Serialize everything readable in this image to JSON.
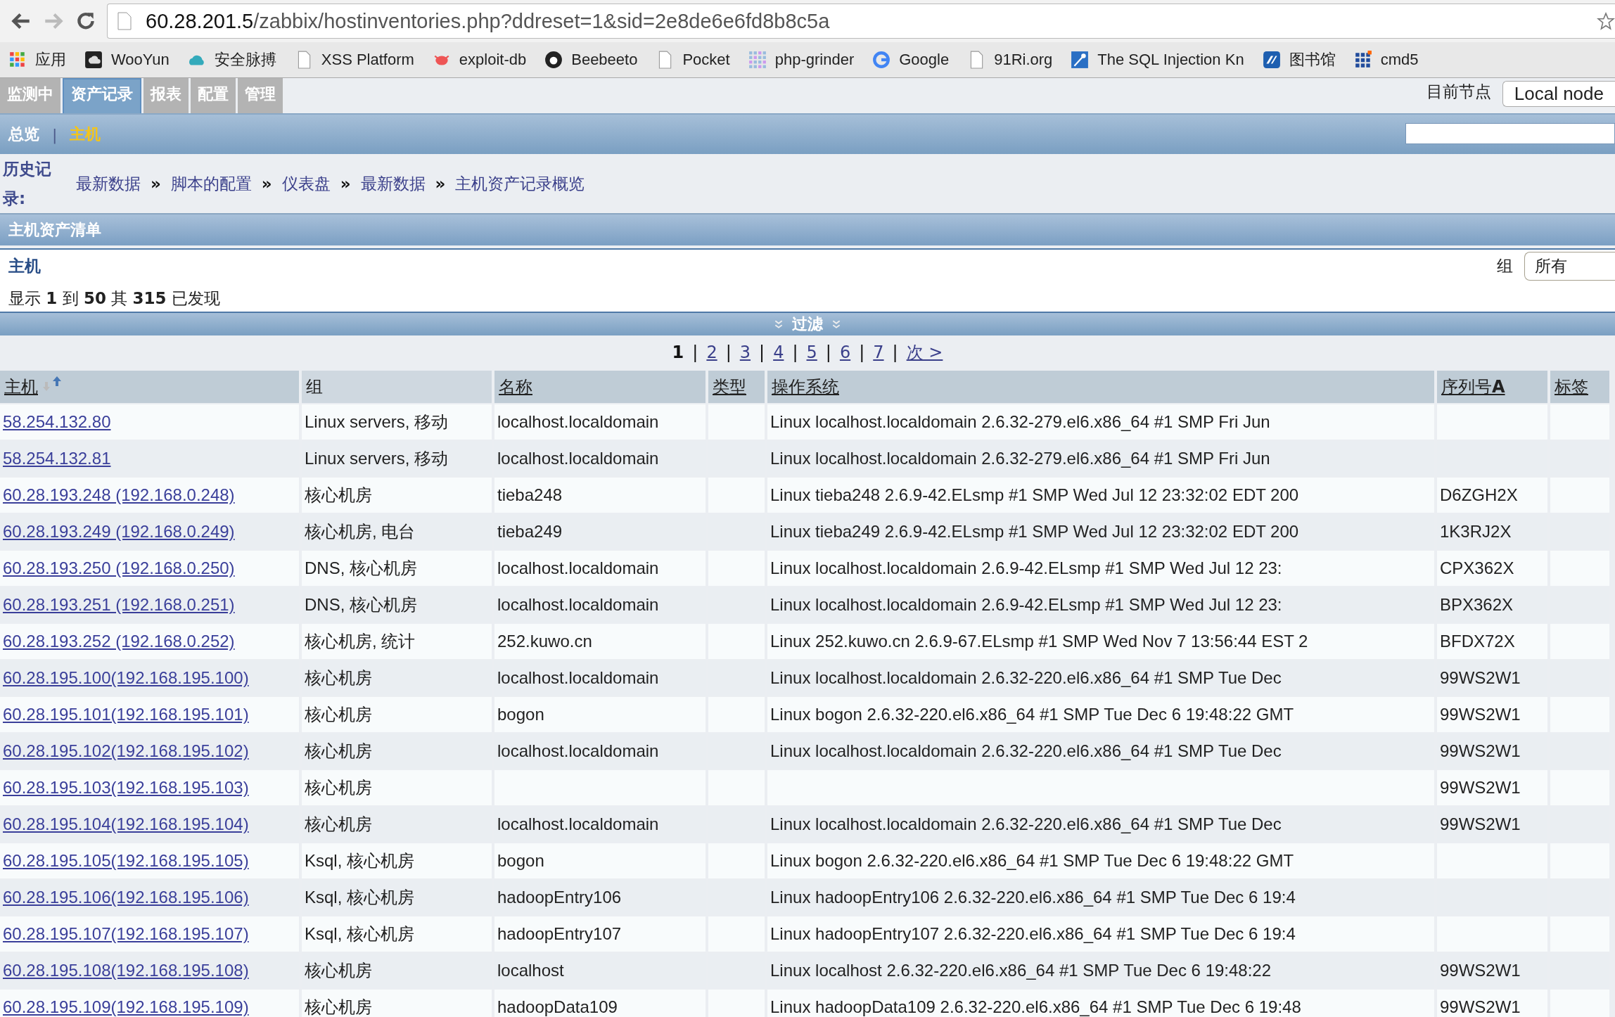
{
  "browser": {
    "url_host": "60.28.201.5",
    "url_path": "/zabbix/hostinventories.php?ddreset=1&sid=2e8de6e6fd8b8c5a",
    "bookmarks": [
      {
        "label": "应用",
        "kind": "apps"
      },
      {
        "label": "WooYun",
        "kind": "dark"
      },
      {
        "label": "安全脉搏",
        "kind": "cloud"
      },
      {
        "label": "XSS Platform",
        "kind": "page"
      },
      {
        "label": "exploit-db",
        "kind": "bug"
      },
      {
        "label": "Beebeeto",
        "kind": "bee"
      },
      {
        "label": "Pocket",
        "kind": "page"
      },
      {
        "label": "php-grinder",
        "kind": "dots"
      },
      {
        "label": "Google",
        "kind": "google"
      },
      {
        "label": "91Ri.org",
        "kind": "page"
      },
      {
        "label": "The SQL Injection Kn",
        "kind": "pin"
      },
      {
        "label": "图书馆",
        "kind": "blue"
      },
      {
        "label": "cmd5",
        "kind": "squares"
      }
    ]
  },
  "main_menu": [
    {
      "label": "监测中",
      "selected": false
    },
    {
      "label": "资产记录",
      "selected": true
    },
    {
      "label": "报表",
      "selected": false
    },
    {
      "label": "配置",
      "selected": false
    },
    {
      "label": "管理",
      "selected": false
    }
  ],
  "node": {
    "label": "目前节点",
    "value": "Local node"
  },
  "sub_menu": [
    {
      "label": "总览",
      "selected": false
    },
    {
      "label": "主机",
      "selected": true
    }
  ],
  "sub_separator": "|",
  "history": {
    "label": "历史记录:",
    "items": [
      "最新数据",
      "脚本的配置",
      "仪表盘",
      "最新数据",
      "主机资产记录概览"
    ],
    "separator": "»"
  },
  "section_title": "主机资产清单",
  "panel": {
    "title": "主机",
    "group_label": "组",
    "group_value": "所有",
    "summary": "显示 **1** 到 **50** 其 **315** 已发现"
  },
  "filter": {
    "label": "过滤"
  },
  "pagination": {
    "pages": [
      {
        "label": "1",
        "selected": true
      },
      {
        "label": "2",
        "selected": false
      },
      {
        "label": "3",
        "selected": false
      },
      {
        "label": "4",
        "selected": false
      },
      {
        "label": "5",
        "selected": false
      },
      {
        "label": "6",
        "selected": false
      },
      {
        "label": "7",
        "selected": false
      }
    ],
    "next": "次 >",
    "separator": "|"
  },
  "table": {
    "columns": [
      {
        "label": "主机",
        "link": true,
        "sorted": true
      },
      {
        "label": "组",
        "link": false,
        "sorted": false
      },
      {
        "label": "名称",
        "link": true,
        "sorted": false
      },
      {
        "label": "类型",
        "link": true,
        "sorted": false
      },
      {
        "label": "操作系统",
        "link": true,
        "sorted": false
      },
      {
        "label": "序列号**A**",
        "link": true,
        "sorted": false
      },
      {
        "label": "标签",
        "link": true,
        "sorted": false
      }
    ],
    "rows": [
      {
        "host": "58.254.132.80",
        "group": "Linux servers, 移动",
        "name": "localhost.localdomain",
        "os": "Linux localhost.localdomain 2.6.32-279.el6.x86_64 #1 SMP Fri Jun"
      },
      {
        "host": "58.254.132.81",
        "group": "Linux servers, 移动",
        "name": "localhost.localdomain",
        "os": "Linux localhost.localdomain 2.6.32-279.el6.x86_64 #1 SMP Fri Jun"
      },
      {
        "host": "60.28.193.248 (192.168.0.248)",
        "group": "核心机房",
        "name": "tieba248",
        "os": "Linux tieba248 2.6.9-42.ELsmp #1 SMP Wed Jul 12 23:32:02 EDT 200",
        "serial": "D6ZGH2X"
      },
      {
        "host": "60.28.193.249 (192.168.0.249)",
        "group": "核心机房, 电台",
        "name": "tieba249",
        "os": "Linux tieba249 2.6.9-42.ELsmp #1 SMP Wed Jul 12 23:32:02 EDT 200",
        "serial": "1K3RJ2X"
      },
      {
        "host": "60.28.193.250 (192.168.0.250)",
        "group": "DNS, 核心机房",
        "name": "localhost.localdomain",
        "os": "Linux localhost.localdomain 2.6.9-42.ELsmp #1 SMP Wed Jul 12 23:",
        "serial": "CPX362X"
      },
      {
        "host": "60.28.193.251 (192.168.0.251)",
        "group": "DNS, 核心机房",
        "name": "localhost.localdomain",
        "os": "Linux localhost.localdomain 2.6.9-42.ELsmp #1 SMP Wed Jul 12 23:",
        "serial": "BPX362X"
      },
      {
        "host": "60.28.193.252 (192.168.0.252)",
        "group": "核心机房, 统计",
        "name": "252.kuwo.cn",
        "os": "Linux 252.kuwo.cn 2.6.9-67.ELsmp #1 SMP Wed Nov 7 13:56:44 EST 2",
        "serial": "BFDX72X"
      },
      {
        "host": "60.28.195.100(192.168.195.100)",
        "group": "核心机房",
        "name": "localhost.localdomain",
        "os": "Linux localhost.localdomain 2.6.32-220.el6.x86_64 #1 SMP Tue Dec",
        "serial": "99WS2W1"
      },
      {
        "host": "60.28.195.101(192.168.195.101)",
        "group": "核心机房",
        "name": "bogon",
        "os": "Linux bogon 2.6.32-220.el6.x86_64 #1 SMP Tue Dec 6 19:48:22 GMT",
        "serial": "99WS2W1"
      },
      {
        "host": "60.28.195.102(192.168.195.102)",
        "group": "核心机房",
        "name": "localhost.localdomain",
        "os": "Linux localhost.localdomain 2.6.32-220.el6.x86_64 #1 SMP Tue Dec",
        "serial": "99WS2W1"
      },
      {
        "host": "60.28.195.103(192.168.195.103)",
        "group": "核心机房",
        "serial": "99WS2W1"
      },
      {
        "host": "60.28.195.104(192.168.195.104)",
        "group": "核心机房",
        "name": "localhost.localdomain",
        "os": "Linux localhost.localdomain 2.6.32-220.el6.x86_64 #1 SMP Tue Dec",
        "serial": "99WS2W1"
      },
      {
        "host": "60.28.195.105(192.168.195.105)",
        "group": "Ksql, 核心机房",
        "name": "bogon",
        "os": "Linux bogon 2.6.32-220.el6.x86_64 #1 SMP Tue Dec 6 19:48:22 GMT"
      },
      {
        "host": "60.28.195.106(192.168.195.106)",
        "group": "Ksql, 核心机房",
        "name": "hadoopEntry106",
        "os": "Linux hadoopEntry106 2.6.32-220.el6.x86_64 #1 SMP Tue Dec 6 19:4"
      },
      {
        "host": "60.28.195.107(192.168.195.107)",
        "group": "Ksql, 核心机房",
        "name": "hadoopEntry107",
        "os": "Linux hadoopEntry107 2.6.32-220.el6.x86_64 #1 SMP Tue Dec 6 19:4"
      },
      {
        "host": "60.28.195.108(192.168.195.108)",
        "group": "核心机房",
        "name": "localhost",
        "os": "Linux localhost 2.6.32-220.el6.x86_64 #1 SMP Tue Dec 6 19:48:22",
        "serial": "99WS2W1"
      },
      {
        "host": "60.28.195.109(192.168.195.109)",
        "group": "核心机房",
        "name": "hadoopData109",
        "os": "Linux hadoopData109 2.6.32-220.el6.x86_64 #1 SMP Tue Dec 6 19:48",
        "serial": "99WS2W1"
      }
    ]
  }
}
